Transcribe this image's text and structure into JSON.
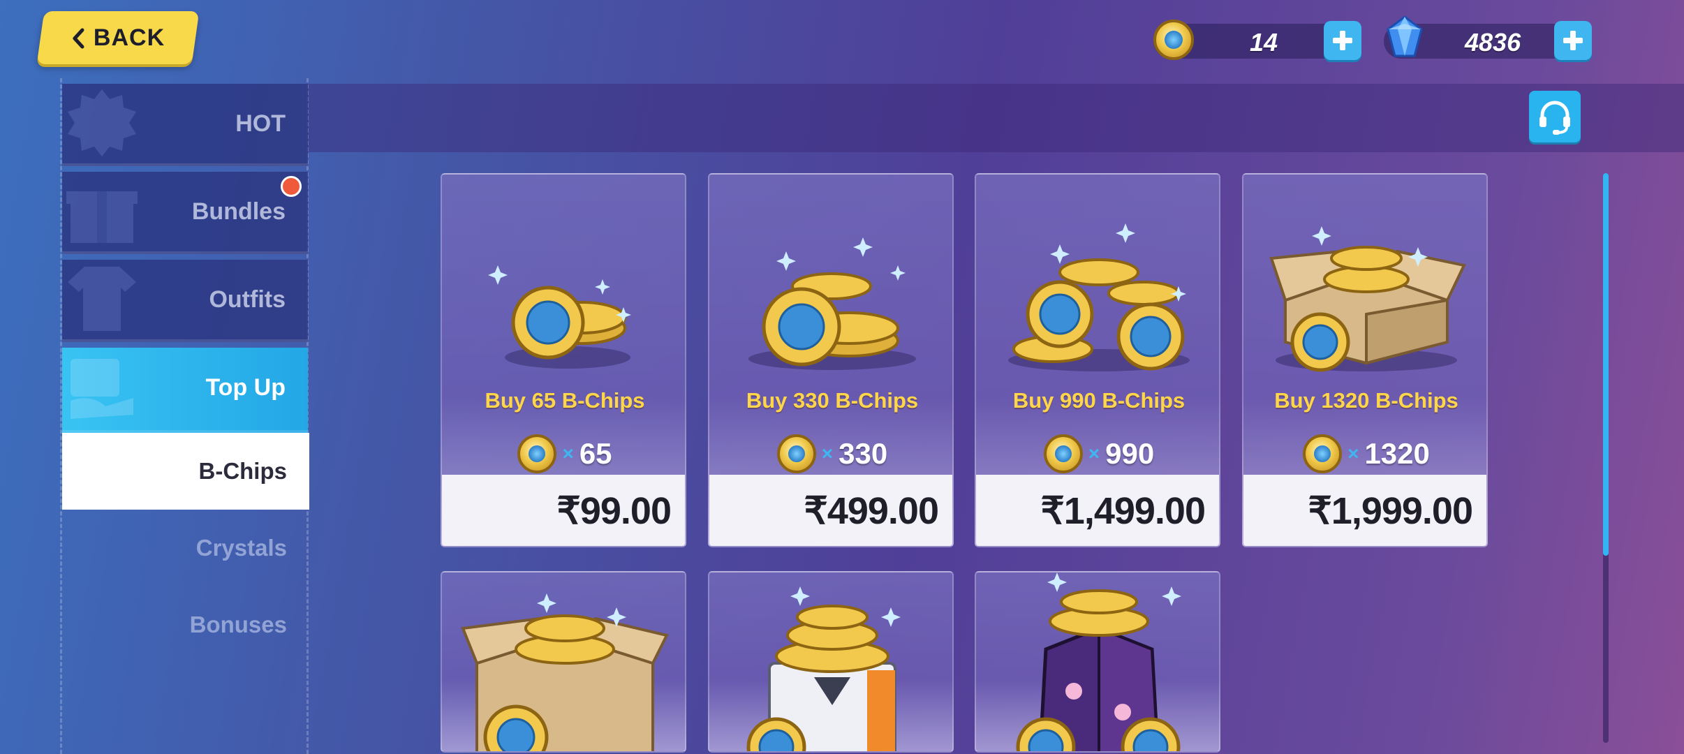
{
  "header": {
    "back_label": "BACK",
    "bchips_amount": "14",
    "crystals_amount": "4836"
  },
  "sidebar": {
    "items": [
      {
        "label": "HOT",
        "icon": "hot-badge-icon"
      },
      {
        "label": "Bundles",
        "icon": "gift-icon",
        "has_notification": true
      },
      {
        "label": "Outfits",
        "icon": "outfit-icon"
      },
      {
        "label": "Top Up",
        "icon": "top-up-icon",
        "active": true
      }
    ],
    "subitems": [
      {
        "label": "B-Chips",
        "selected": true
      },
      {
        "label": "Crystals"
      },
      {
        "label": "Bonuses"
      }
    ]
  },
  "products": [
    {
      "title_prefix": "Buy ",
      "title_amount": "65",
      "title_suffix": " B-Chips",
      "times": "×",
      "quantity": "65",
      "price": "₹99.00"
    },
    {
      "title_prefix": "Buy ",
      "title_amount": "330",
      "title_suffix": " B-Chips",
      "times": "×",
      "quantity": "330",
      "price": "₹499.00"
    },
    {
      "title_prefix": "Buy ",
      "title_amount": "990",
      "title_suffix": " B-Chips",
      "times": "×",
      "quantity": "990",
      "price": "₹1,499.00"
    },
    {
      "title_prefix": "Buy ",
      "title_amount": "1320",
      "title_suffix": " B-Chips",
      "times": "×",
      "quantity": "1320",
      "price": "₹1,999.00"
    }
  ],
  "colors": {
    "accent_blue": "#3fb6f0",
    "back_yellow": "#f7d94a",
    "title_gold": "#ffd64a",
    "notification_red": "#ef5a3c"
  }
}
